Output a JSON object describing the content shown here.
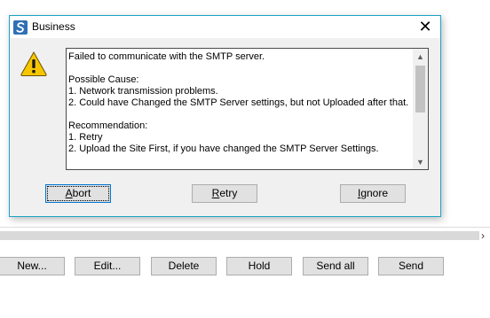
{
  "dialog": {
    "title": "Business",
    "close_glyph": "✕",
    "message": "Failed to communicate with the SMTP server.\n\nPossible Cause:\n1. Network transmission problems.\n2. Could have Changed the SMTP Server settings, but not Uploaded after that.\n\nRecommendation:\n1. Retry\n2. Upload the Site First, if you have changed the SMTP Server Settings.",
    "buttons": {
      "abort": {
        "mnemonic": "A",
        "rest": "bort"
      },
      "retry": {
        "mnemonic": "R",
        "rest": "etry"
      },
      "ignore": {
        "mnemonic": "I",
        "rest": "gnore"
      }
    },
    "icons": {
      "app": "app-logo-icon",
      "warning": "warning-icon",
      "close": "close-icon"
    },
    "colors": {
      "accent_border": "#1ba3c2",
      "warning_fill": "#f7c600"
    }
  },
  "background": {
    "scroll_arrow": "›",
    "buttons": {
      "new": "New...",
      "edit": "Edit...",
      "delete": "Delete",
      "hold": "Hold",
      "send_all": "Send all",
      "send": "Send"
    }
  }
}
